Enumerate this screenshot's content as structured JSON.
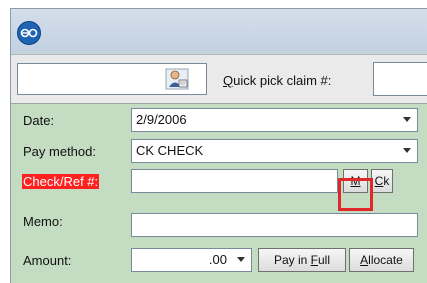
{
  "toolbar": {
    "search_value": "",
    "patient_icon": "person-with-card-icon",
    "quick_pick_label_accel": "Q",
    "quick_pick_label_rest": "uick pick claim #:",
    "quick_pick_value": ""
  },
  "form": {
    "date": {
      "label": "Date:",
      "value": "2/9/2006"
    },
    "pay_method": {
      "label": "Pay method:",
      "value": "CK  CHECK"
    },
    "check_ref": {
      "label": "Check/Ref #:",
      "value": "",
      "label_color": "#ff2020"
    },
    "m_button": {
      "label": "M",
      "highlight_color": "#e0282a"
    },
    "ck_button": {
      "accel": "C",
      "rest": "k"
    },
    "memo": {
      "label": "Memo:",
      "value": ""
    },
    "amount": {
      "label": "Amount:",
      "value": ".00"
    },
    "pay_in_full": {
      "prefix": "Pay in ",
      "accel": "F",
      "rest": "ull"
    },
    "allocate": {
      "accel": "A",
      "rest": "llocate"
    }
  },
  "colors": {
    "form_bg": "#c4dcc2",
    "title_bg": "#c8d5e5",
    "app_logo": "#1f63b6"
  }
}
